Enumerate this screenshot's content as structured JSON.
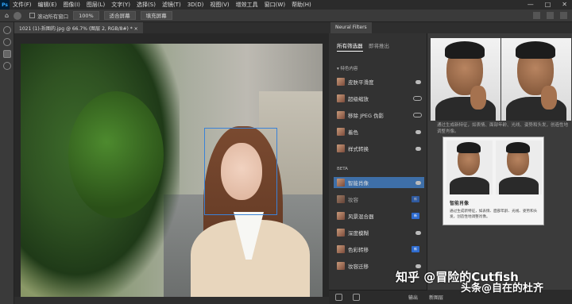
{
  "app": {
    "logo": "Ps"
  },
  "menubar": {
    "items": [
      "文件(F)",
      "编辑(E)",
      "图像(I)",
      "图层(L)",
      "文字(Y)",
      "选择(S)",
      "滤镜(T)",
      "3D(D)",
      "视图(V)",
      "增效工具",
      "窗口(W)",
      "帮助(H)"
    ],
    "window_controls": [
      "—",
      "□",
      "✕"
    ]
  },
  "options_bar": {
    "scroll_all_label": "滚动所有窗口",
    "zoom_value": "100%",
    "fit_screen": "适合屏幕",
    "fill_screen": "填充屏幕"
  },
  "document": {
    "tab_title": "1021 (1)-拆图的.jpg @ 66.7% (图层 2, RGB/8#) *  ×"
  },
  "neural_filters": {
    "panel_tab": "Neural Filters",
    "tabs": [
      "所有筛选器",
      "即将推出"
    ],
    "section_featured": "▾ 特色内容",
    "section_beta": "BETA",
    "featured": [
      {
        "label": "皮肤平滑度",
        "control": "cloud"
      },
      {
        "label": "超级缩放",
        "control": "toggle"
      },
      {
        "label": "移除 JPEG 伪影",
        "control": "toggle"
      },
      {
        "label": "着色",
        "control": "cloud"
      },
      {
        "label": "样式转换",
        "control": "cloud"
      }
    ],
    "beta": [
      {
        "label": "智能肖像",
        "control": "cloud",
        "selected": true
      },
      {
        "label": "妆容",
        "control": "badge",
        "badge": "新"
      },
      {
        "label": "风景混合器",
        "control": "badge",
        "badge": "新"
      },
      {
        "label": "深度模糊",
        "control": "cloud"
      },
      {
        "label": "色彩转移",
        "control": "badge",
        "badge": "新"
      },
      {
        "label": "妆容迁移",
        "control": "cloud"
      }
    ]
  },
  "preview": {
    "caption": "通过生成新特征，如表情、面部年龄、光线、姿势和头发，创造性地调整肖像。",
    "bottom_output": "输出",
    "bottom_new_layer": "新图层"
  },
  "popup": {
    "title": "智能肖像",
    "description": "通过生成新特征，如表情、面部年龄、光线、姿势和头发，创造性地调整肖像。"
  },
  "watermark": {
    "line1": "知乎 @冒险的Cutfish",
    "line2": "头条@自在的杜齐"
  }
}
